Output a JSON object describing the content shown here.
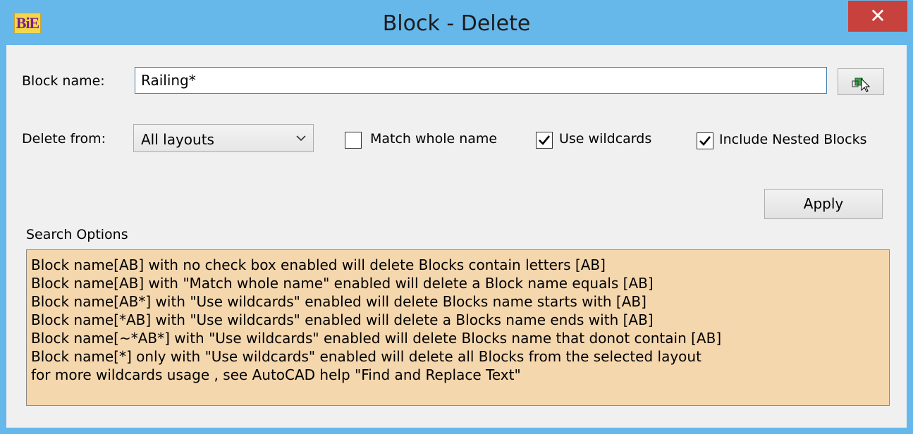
{
  "window": {
    "title": "Block - Delete",
    "app_icon_text": "BiE",
    "close_symbol": "✕"
  },
  "form": {
    "block_name_label": "Block name:",
    "block_name_value": "Railing*",
    "pick_icon": "block-pick-icon",
    "delete_from_label": "Delete from:",
    "delete_from_selected": "All layouts",
    "match_whole_name": {
      "label": "Match whole name",
      "checked": false
    },
    "use_wildcards": {
      "label": "Use wildcards",
      "checked": true
    },
    "include_nested": {
      "label": "Include Nested Blocks",
      "checked": true
    },
    "apply_label": "Apply"
  },
  "search_options": {
    "title": "Search Options",
    "lines": [
      "Block name[AB] with no check box enabled will delete  Blocks contain letters [AB]",
      "Block name[AB] with \"Match whole name\" enabled will delete a Block name equals [AB]",
      "Block name[AB*] with \"Use wildcards\" enabled will delete  Blocks name starts with [AB]",
      "Block name[*AB] with \"Use wildcards\" enabled will delete a Blocks name ends with [AB]",
      "Block name[~*AB*] with \"Use wildcards\" enabled will delete Blocks name that donot contain [AB]",
      "Block name[*] only with \"Use wildcards\" enabled will delete all Blocks from the selected layout",
      "for more wildcards usage , see AutoCAD help  \"Find and Replace Text\""
    ]
  }
}
